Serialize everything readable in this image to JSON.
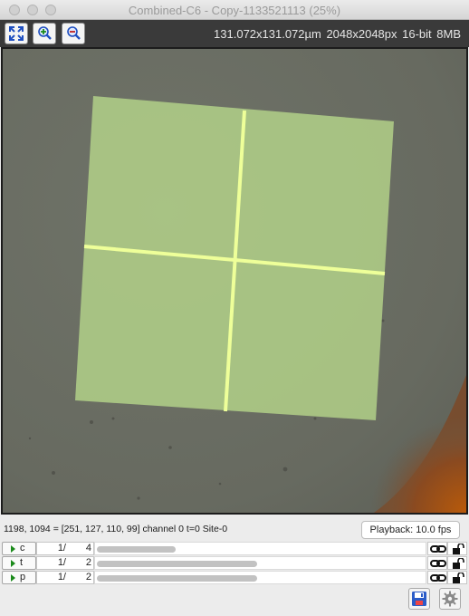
{
  "window": {
    "title": "Combined-C6 - Copy-1133521113 (25%)"
  },
  "toolbar": {
    "buttons": [
      {
        "name": "fit-to-window",
        "icon": "expand-arrows-icon"
      },
      {
        "name": "zoom-in",
        "icon": "magnifier-plus-icon"
      },
      {
        "name": "zoom-out",
        "icon": "magnifier-minus-icon"
      }
    ],
    "info": "131.072x131.072µm  2048x2048px  16-bit 8MB"
  },
  "status": {
    "text": "1198, 1094 = [251, 127, 110, 99]   channel 0  t=0 Site-0",
    "playback": "Playback: 10.0 fps"
  },
  "axes": [
    {
      "name": "c",
      "position": "1/",
      "total": "4",
      "fill": 0.24
    },
    {
      "name": "t",
      "position": "1/",
      "total": "2",
      "fill": 0.49
    },
    {
      "name": "p",
      "position": "1/",
      "total": "2",
      "fill": 0.49
    }
  ],
  "bottom": {
    "save_icon": "floppy-disk-icon",
    "settings_icon": "gear-icon"
  },
  "colors": {
    "toolbar_bg": "#3a3a3a",
    "overlay": "#b8d88a",
    "crosshair": "#eeff99",
    "background_tissue": "#6a6f63"
  }
}
